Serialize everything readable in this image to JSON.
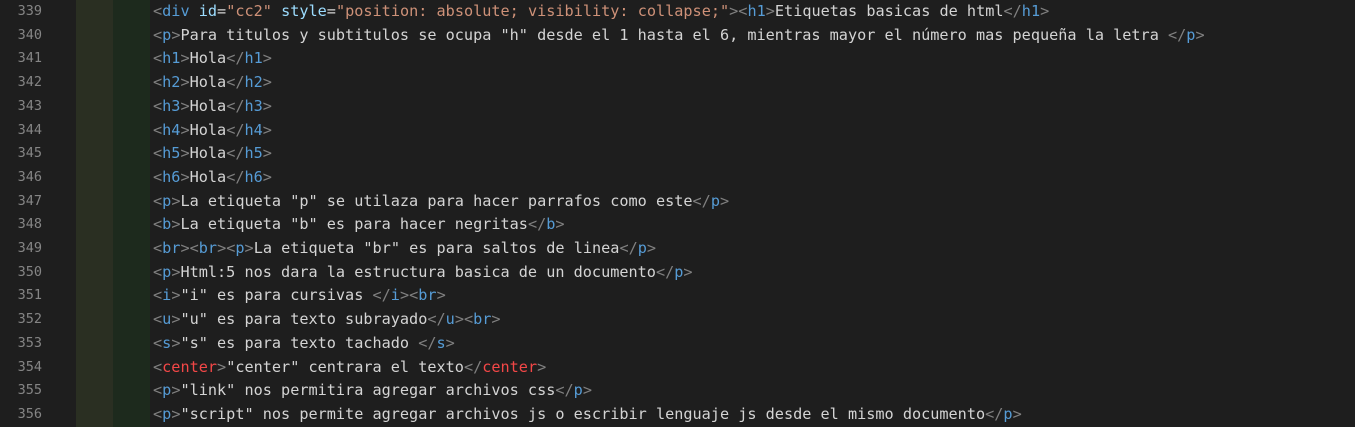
{
  "lines": [
    {
      "no": "339",
      "tokens": [
        {
          "t": "<",
          "c": "bracket"
        },
        {
          "t": "div",
          "c": "tag"
        },
        {
          "t": " ",
          "c": "text"
        },
        {
          "t": "id",
          "c": "attr"
        },
        {
          "t": "=",
          "c": "text"
        },
        {
          "t": "\"cc2\"",
          "c": "str"
        },
        {
          "t": " ",
          "c": "text"
        },
        {
          "t": "style",
          "c": "attr"
        },
        {
          "t": "=",
          "c": "text"
        },
        {
          "t": "\"position: absolute; visibility: collapse;\"",
          "c": "str"
        },
        {
          "t": ">",
          "c": "bracket"
        },
        {
          "t": "<",
          "c": "bracket"
        },
        {
          "t": "h1",
          "c": "tag"
        },
        {
          "t": ">",
          "c": "bracket"
        },
        {
          "t": "Etiquetas basicas de html",
          "c": "text"
        },
        {
          "t": "</",
          "c": "bracket"
        },
        {
          "t": "h1",
          "c": "tag"
        },
        {
          "t": ">",
          "c": "bracket"
        }
      ]
    },
    {
      "no": "340",
      "tokens": [
        {
          "t": "<",
          "c": "bracket"
        },
        {
          "t": "p",
          "c": "tag"
        },
        {
          "t": ">",
          "c": "bracket"
        },
        {
          "t": "Para titulos y subtitulos se ocupa \"h\" desde el 1 hasta el 6, mientras mayor el número mas pequeña la letra ",
          "c": "text"
        },
        {
          "t": "</",
          "c": "bracket"
        },
        {
          "t": "p",
          "c": "tag"
        },
        {
          "t": ">",
          "c": "bracket"
        }
      ]
    },
    {
      "no": "341",
      "tokens": [
        {
          "t": "<",
          "c": "bracket"
        },
        {
          "t": "h1",
          "c": "tag"
        },
        {
          "t": ">",
          "c": "bracket"
        },
        {
          "t": "Hola",
          "c": "text"
        },
        {
          "t": "</",
          "c": "bracket"
        },
        {
          "t": "h1",
          "c": "tag"
        },
        {
          "t": ">",
          "c": "bracket"
        }
      ]
    },
    {
      "no": "342",
      "tokens": [
        {
          "t": "<",
          "c": "bracket"
        },
        {
          "t": "h2",
          "c": "tag"
        },
        {
          "t": ">",
          "c": "bracket"
        },
        {
          "t": "Hola",
          "c": "text"
        },
        {
          "t": "</",
          "c": "bracket"
        },
        {
          "t": "h2",
          "c": "tag"
        },
        {
          "t": ">",
          "c": "bracket"
        }
      ]
    },
    {
      "no": "343",
      "tokens": [
        {
          "t": "<",
          "c": "bracket"
        },
        {
          "t": "h3",
          "c": "tag"
        },
        {
          "t": ">",
          "c": "bracket"
        },
        {
          "t": "Hola",
          "c": "text"
        },
        {
          "t": "</",
          "c": "bracket"
        },
        {
          "t": "h3",
          "c": "tag"
        },
        {
          "t": ">",
          "c": "bracket"
        }
      ]
    },
    {
      "no": "344",
      "tokens": [
        {
          "t": "<",
          "c": "bracket"
        },
        {
          "t": "h4",
          "c": "tag"
        },
        {
          "t": ">",
          "c": "bracket"
        },
        {
          "t": "Hola",
          "c": "text"
        },
        {
          "t": "</",
          "c": "bracket"
        },
        {
          "t": "h4",
          "c": "tag"
        },
        {
          "t": ">",
          "c": "bracket"
        }
      ]
    },
    {
      "no": "345",
      "tokens": [
        {
          "t": "<",
          "c": "bracket"
        },
        {
          "t": "h5",
          "c": "tag"
        },
        {
          "t": ">",
          "c": "bracket"
        },
        {
          "t": "Hola",
          "c": "text"
        },
        {
          "t": "</",
          "c": "bracket"
        },
        {
          "t": "h5",
          "c": "tag"
        },
        {
          "t": ">",
          "c": "bracket"
        }
      ]
    },
    {
      "no": "346",
      "tokens": [
        {
          "t": "<",
          "c": "bracket"
        },
        {
          "t": "h6",
          "c": "tag"
        },
        {
          "t": ">",
          "c": "bracket"
        },
        {
          "t": "Hola",
          "c": "text"
        },
        {
          "t": "</",
          "c": "bracket"
        },
        {
          "t": "h6",
          "c": "tag"
        },
        {
          "t": ">",
          "c": "bracket"
        }
      ]
    },
    {
      "no": "347",
      "tokens": [
        {
          "t": "<",
          "c": "bracket"
        },
        {
          "t": "p",
          "c": "tag"
        },
        {
          "t": ">",
          "c": "bracket"
        },
        {
          "t": "La etiqueta \"p\" se utilaza para hacer parrafos como este",
          "c": "text"
        },
        {
          "t": "</",
          "c": "bracket"
        },
        {
          "t": "p",
          "c": "tag"
        },
        {
          "t": ">",
          "c": "bracket"
        }
      ]
    },
    {
      "no": "348",
      "tokens": [
        {
          "t": "<",
          "c": "bracket"
        },
        {
          "t": "b",
          "c": "tag"
        },
        {
          "t": ">",
          "c": "bracket"
        },
        {
          "t": "La etiqueta \"b\" es para hacer negritas",
          "c": "text"
        },
        {
          "t": "</",
          "c": "bracket"
        },
        {
          "t": "b",
          "c": "tag"
        },
        {
          "t": ">",
          "c": "bracket"
        }
      ]
    },
    {
      "no": "349",
      "tokens": [
        {
          "t": "<",
          "c": "bracket"
        },
        {
          "t": "br",
          "c": "tag"
        },
        {
          "t": ">",
          "c": "bracket"
        },
        {
          "t": "<",
          "c": "bracket"
        },
        {
          "t": "br",
          "c": "tag"
        },
        {
          "t": ">",
          "c": "bracket"
        },
        {
          "t": "<",
          "c": "bracket"
        },
        {
          "t": "p",
          "c": "tag"
        },
        {
          "t": ">",
          "c": "bracket"
        },
        {
          "t": "La etiqueta \"br\" es para saltos de linea",
          "c": "text"
        },
        {
          "t": "</",
          "c": "bracket"
        },
        {
          "t": "p",
          "c": "tag"
        },
        {
          "t": ">",
          "c": "bracket"
        }
      ]
    },
    {
      "no": "350",
      "tokens": [
        {
          "t": "<",
          "c": "bracket"
        },
        {
          "t": "p",
          "c": "tag"
        },
        {
          "t": ">",
          "c": "bracket"
        },
        {
          "t": "Html:5 nos dara la estructura basica de un documento",
          "c": "text"
        },
        {
          "t": "</",
          "c": "bracket"
        },
        {
          "t": "p",
          "c": "tag"
        },
        {
          "t": ">",
          "c": "bracket"
        }
      ]
    },
    {
      "no": "351",
      "tokens": [
        {
          "t": "<",
          "c": "bracket"
        },
        {
          "t": "i",
          "c": "tag"
        },
        {
          "t": ">",
          "c": "bracket"
        },
        {
          "t": "\"i\" es para cursivas ",
          "c": "text"
        },
        {
          "t": "</",
          "c": "bracket"
        },
        {
          "t": "i",
          "c": "tag"
        },
        {
          "t": ">",
          "c": "bracket"
        },
        {
          "t": "<",
          "c": "bracket"
        },
        {
          "t": "br",
          "c": "tag"
        },
        {
          "t": ">",
          "c": "bracket"
        }
      ]
    },
    {
      "no": "352",
      "tokens": [
        {
          "t": "<",
          "c": "bracket"
        },
        {
          "t": "u",
          "c": "tag"
        },
        {
          "t": ">",
          "c": "bracket"
        },
        {
          "t": "\"u\" es para texto subrayado",
          "c": "text"
        },
        {
          "t": "</",
          "c": "bracket"
        },
        {
          "t": "u",
          "c": "tag"
        },
        {
          "t": ">",
          "c": "bracket"
        },
        {
          "t": "<",
          "c": "bracket"
        },
        {
          "t": "br",
          "c": "tag"
        },
        {
          "t": ">",
          "c": "bracket"
        }
      ]
    },
    {
      "no": "353",
      "tokens": [
        {
          "t": "<",
          "c": "bracket"
        },
        {
          "t": "s",
          "c": "tag"
        },
        {
          "t": ">",
          "c": "bracket"
        },
        {
          "t": "\"s\" es para texto tachado ",
          "c": "text"
        },
        {
          "t": "</",
          "c": "bracket"
        },
        {
          "t": "s",
          "c": "tag"
        },
        {
          "t": ">",
          "c": "bracket"
        }
      ]
    },
    {
      "no": "354",
      "tokens": [
        {
          "t": "<",
          "c": "bracket"
        },
        {
          "t": "center",
          "c": "center"
        },
        {
          "t": ">",
          "c": "bracket"
        },
        {
          "t": "\"center\" centrara el texto",
          "c": "text"
        },
        {
          "t": "</",
          "c": "bracket"
        },
        {
          "t": "center",
          "c": "center"
        },
        {
          "t": ">",
          "c": "bracket"
        }
      ]
    },
    {
      "no": "355",
      "tokens": [
        {
          "t": "<",
          "c": "bracket"
        },
        {
          "t": "p",
          "c": "tag"
        },
        {
          "t": ">",
          "c": "bracket"
        },
        {
          "t": "\"link\" nos permitira agregar archivos css",
          "c": "text"
        },
        {
          "t": "</",
          "c": "bracket"
        },
        {
          "t": "p",
          "c": "tag"
        },
        {
          "t": ">",
          "c": "bracket"
        }
      ]
    },
    {
      "no": "356",
      "tokens": [
        {
          "t": "<",
          "c": "bracket"
        },
        {
          "t": "p",
          "c": "tag"
        },
        {
          "t": ">",
          "c": "bracket"
        },
        {
          "t": "\"script\" nos permite agregar archivos js o escribir lenguaje js desde el mismo documento",
          "c": "text"
        },
        {
          "t": "</",
          "c": "bracket"
        },
        {
          "t": "p",
          "c": "tag"
        },
        {
          "t": ">",
          "c": "bracket"
        }
      ]
    }
  ]
}
